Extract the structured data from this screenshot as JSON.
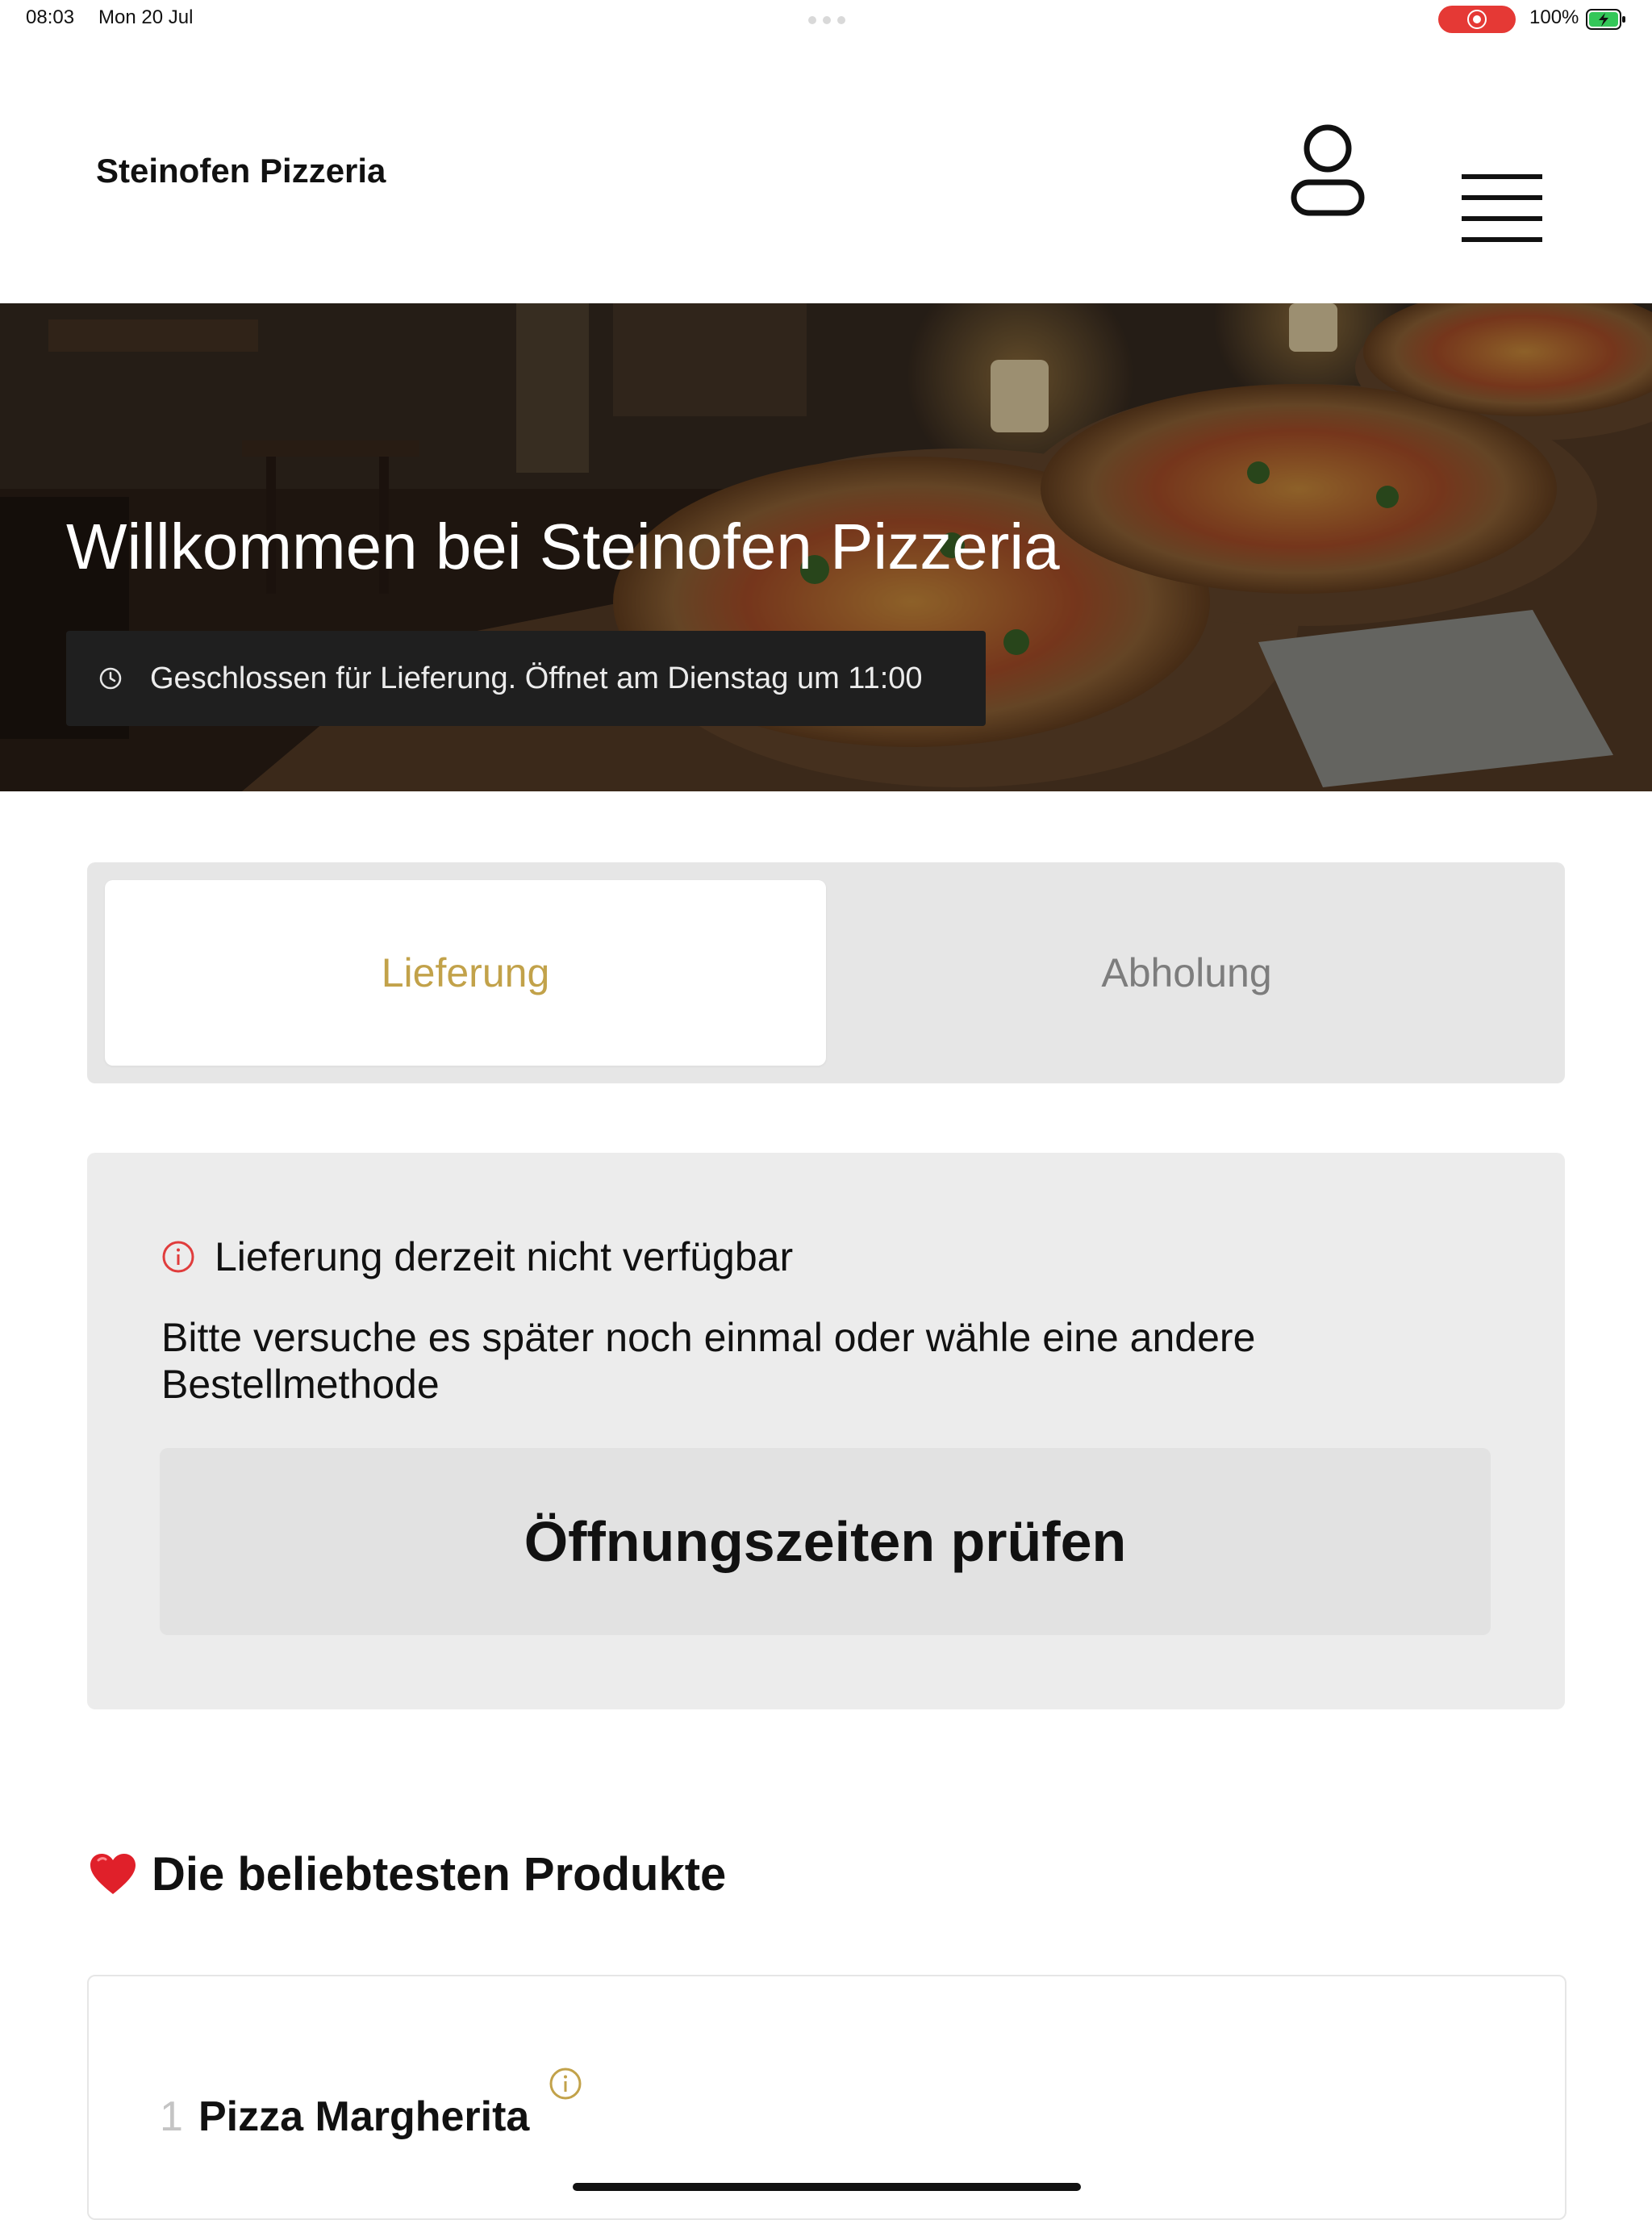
{
  "status_bar": {
    "time": "08:03",
    "date": "Mon 20 Jul",
    "battery": "100%",
    "icons": [
      "screen-recording-icon",
      "battery-charging-icon"
    ]
  },
  "header": {
    "brand": "Steinofen Pizzeria",
    "icons": [
      "account-icon",
      "hamburger-menu-icon"
    ]
  },
  "hero": {
    "title": "Willkommen bei Steinofen Pizzeria",
    "status": "Geschlossen für Lieferung. Öffnet am Dienstag um 11:00",
    "icon": "clock-icon"
  },
  "order_methods": {
    "tabs": [
      {
        "label": "Lieferung",
        "selected": true
      },
      {
        "label": "Abholung",
        "selected": false
      }
    ],
    "accent_color": "#C2A24A"
  },
  "notice": {
    "icon": "info-icon",
    "title": "Lieferung derzeit nicht verfügbar",
    "message": "Bitte versuche es später noch einmal oder wähle eine andere Bestellmethode",
    "button_label": "Öffnungszeiten prüfen",
    "icon_color": "#E03C3C"
  },
  "popular": {
    "icon": "heart-icon",
    "title": "Die beliebtesten Produkte",
    "products": [
      {
        "rank": "1",
        "name": "Pizza Margherita",
        "icon": "info-icon"
      }
    ]
  }
}
